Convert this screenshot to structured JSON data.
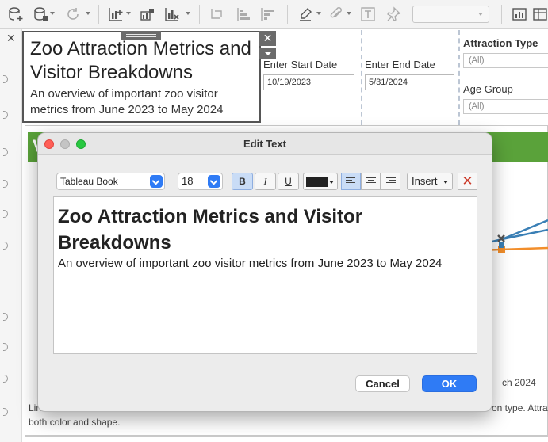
{
  "toolbar": {
    "icons": [
      "new-data-source-icon",
      "paste-data-icon",
      "refresh-icon",
      "new-worksheet-icon",
      "new-dashboard-icon",
      "clear-sheet-icon",
      "swap-icon",
      "sort-ascending-icon",
      "sort-descending-icon",
      "highlight-icon",
      "annotate-icon",
      "text-format-icon",
      "pin-icon",
      "show-me-icon"
    ]
  },
  "title_box": {
    "title": "Zoo Attraction Metrics and Visitor Breakdowns",
    "subtitle": "An overview of important zoo visitor metrics from June 2023 to May 2024"
  },
  "parameters": {
    "start_label": "Enter Start Date",
    "start_value": "10/19/2023",
    "end_label": "Enter End Date",
    "end_value": "5/31/2024"
  },
  "filters": {
    "attraction_label": "Attraction Type",
    "attraction_value": "(All)",
    "age_label": "Age Group",
    "age_value": "(All)"
  },
  "background": {
    "header_letter": "V",
    "text_a": "ch 2024",
    "text_b": "on type. Attra",
    "text_c": "Lin",
    "text_d": "both color and shape."
  },
  "dialog": {
    "title": "Edit Text",
    "font": "Tableau Book",
    "size": "18",
    "bold": "B",
    "italic": "I",
    "underline": "U",
    "insert": "Insert",
    "clear": "✕",
    "text_color": "#222222",
    "editor_title": "Zoo Attraction Metrics and Visitor Breakdowns",
    "editor_subtitle": "An overview of important zoo visitor metrics from June 2023 to May 2024",
    "cancel": "Cancel",
    "ok": "OK"
  },
  "colors": {
    "accent": "#2f7bf5",
    "header_green": "#5aa23a",
    "close_red": "#cc3a2a",
    "traffic_red": "#ff5f57",
    "traffic_gray": "#c4c4c4",
    "traffic_green": "#28c840",
    "line_orange": "#f28e2b",
    "line_blue": "#3a7fb5",
    "marker_gray": "#555555"
  }
}
